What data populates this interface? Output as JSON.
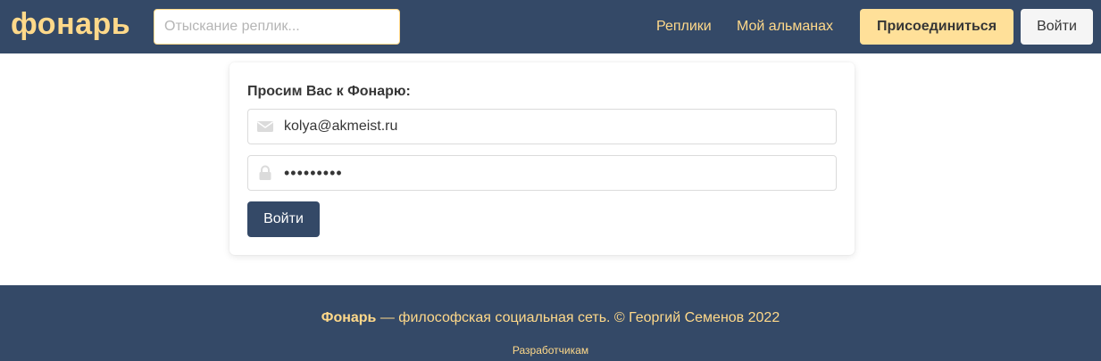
{
  "navbar": {
    "brand": "фонарь",
    "search": {
      "placeholder": "Отыскание реплик...",
      "value": ""
    },
    "links": {
      "replies": "Реплики",
      "almanac": "Мой альманах"
    },
    "join_label": "Присоединиться",
    "login_label": "Войти"
  },
  "login_form": {
    "title": "Просим Вас к Фонарю:",
    "email": {
      "value": "kolya@akmeist.ru",
      "icon": "envelope-icon"
    },
    "password": {
      "value": "•••••••••",
      "icon": "lock-icon"
    },
    "submit_label": "Войти"
  },
  "footer": {
    "brand": "Фонарь",
    "text": " — философская социальная сеть. © Георгий Семенов 2022",
    "dev_link": "Разработчикам"
  },
  "colors": {
    "navbar_bg": "#344967",
    "accent": "#ffd98a",
    "join_button_bg": "#ffe099",
    "submit_button_bg": "#344967",
    "icon_gray": "#dbdbdb"
  }
}
